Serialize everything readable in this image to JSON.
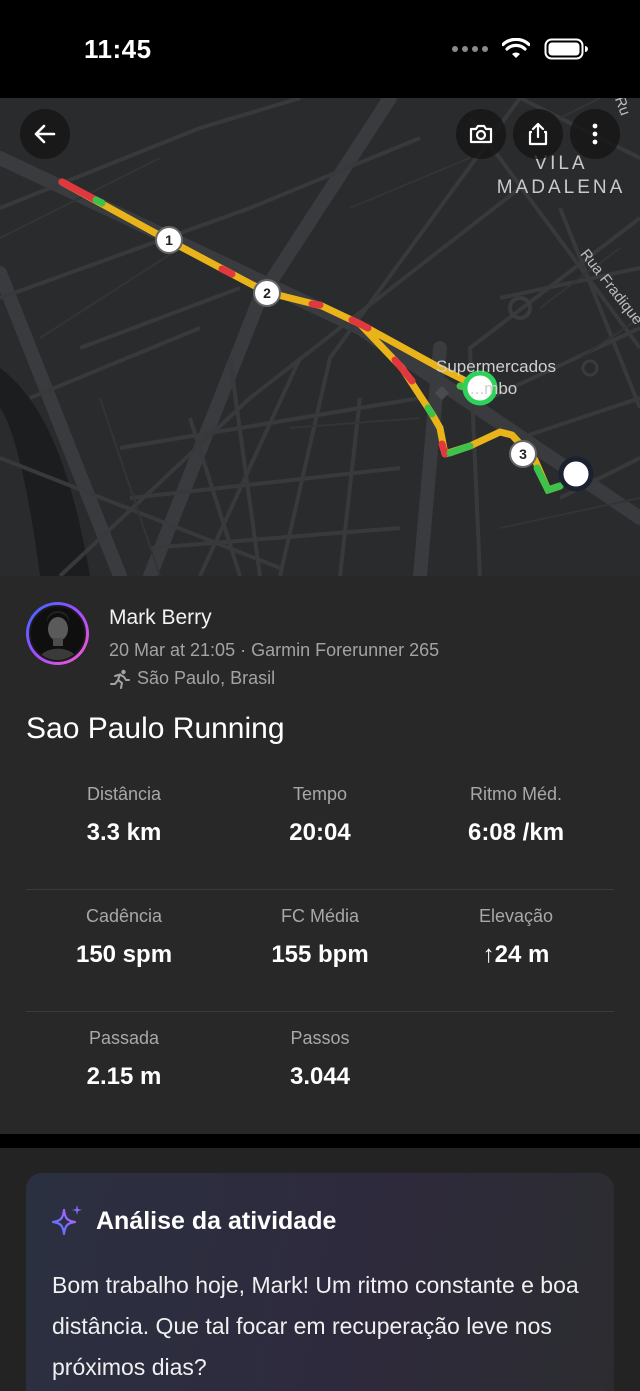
{
  "status_bar": {
    "time": "11:45"
  },
  "map": {
    "neighborhood_line1": "VILA",
    "neighborhood_line2": "MADALENA",
    "street": "Rua Fradique C",
    "corner_text": "Ru",
    "poi_line1": "Supermercados",
    "poi_line2": "...mbo",
    "markers": [
      "1",
      "2",
      "3"
    ],
    "buttons": [
      "arrow-left-icon",
      "camera-icon",
      "share-icon",
      "more-vertical-icon"
    ],
    "colors": {
      "route_yellow": "#e9b41a",
      "route_red": "#e0383e",
      "route_green": "#3fc24b",
      "start": "#2fd15a",
      "end": "#ffffff"
    }
  },
  "activity": {
    "user_name": "Mark Berry",
    "meta": "20 Mar at 21:05 · Garmin Forerunner 265",
    "location": "São Paulo, Brasil",
    "title": "Sao Paulo Running",
    "stats": [
      [
        {
          "label": "Distância",
          "value": "3.3 km"
        },
        {
          "label": "Tempo",
          "value": "20:04"
        },
        {
          "label": "Ritmo Méd.",
          "value": "6:08 /km"
        }
      ],
      [
        {
          "label": "Cadência",
          "value": "150 spm"
        },
        {
          "label": "FC Média",
          "value": "155 bpm"
        },
        {
          "label": "Elevação",
          "value": "↑24 m"
        }
      ],
      [
        {
          "label": "Passada",
          "value": "2.15 m"
        },
        {
          "label": "Passos",
          "value": "3.044"
        }
      ]
    ]
  },
  "analysis": {
    "title": "Análise da atividade",
    "text": "Bom trabalho hoje, Mark! Um ritmo constante e boa distância. Que tal focar em recuperação leve nos próximos dias?"
  }
}
